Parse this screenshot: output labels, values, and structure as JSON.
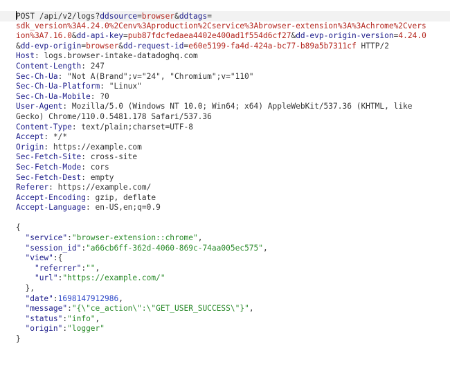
{
  "request_line": {
    "method": "POST",
    "path": "/api/v2/logs?",
    "params": [
      {
        "key": "ddsource",
        "value": "browser"
      },
      {
        "key": "ddtags",
        "value": "sdk_version%3A4.24.0%2Cenv%3Aproduction%2Cservice%3Abrowser-extension%3A%3Achrome%2Cversion%3A7.16.0"
      },
      {
        "key": "dd-api-key",
        "value": "pub87fdcfedaea4402e400ad1f554d6cf27"
      },
      {
        "key": "dd-evp-origin-version",
        "value": "4.24.0"
      },
      {
        "key": "dd-evp-origin",
        "value": "browser"
      },
      {
        "key": "dd-request-id",
        "value": "e60e5199-fa4d-424a-bc77-b89a5b7311cf"
      }
    ],
    "protocol": "HTTP/2",
    "wrapped_lines": {
      "l1_tail": "sdk_version%3A4.24.0%2Cenv%3Aproduction%2Cservice%3Abrowser-extension%3A%3Achrome%2Cvers",
      "l2_head": "ion%3A7.16.0",
      "l3_tail": "4.24.0"
    }
  },
  "headers": [
    {
      "name": "Host",
      "value": "logs.browser-intake-datadoghq.com"
    },
    {
      "name": "Content-Length",
      "value": "247"
    },
    {
      "name": "Sec-Ch-Ua",
      "value": "\"Not A(Brand\";v=\"24\", \"Chromium\";v=\"110\""
    },
    {
      "name": "Sec-Ch-Ua-Platform",
      "value": "\"Linux\""
    },
    {
      "name": "Sec-Ch-Ua-Mobile",
      "value": "?0"
    },
    {
      "name": "User-Agent",
      "value": "Mozilla/5.0 (Windows NT 10.0; Win64; x64) AppleWebKit/537.36 (KHTML, like",
      "continuation": "Gecko) Chrome/110.0.5481.178 Safari/537.36"
    },
    {
      "name": "Content-Type",
      "value": "text/plain;charset=UTF-8"
    },
    {
      "name": "Accept",
      "value": "*/*"
    },
    {
      "name": "Origin",
      "value": "https://example.com"
    },
    {
      "name": "Sec-Fetch-Site",
      "value": "cross-site"
    },
    {
      "name": "Sec-Fetch-Mode",
      "value": "cors"
    },
    {
      "name": "Sec-Fetch-Dest",
      "value": "empty"
    },
    {
      "name": "Referer",
      "value": "https://example.com/"
    },
    {
      "name": "Accept-Encoding",
      "value": "gzip, deflate"
    },
    {
      "name": "Accept-Language",
      "value": "en-US,en;q=0.9"
    }
  ],
  "body": {
    "service": "\"browser-extension::chrome\"",
    "session_id": "\"a66cb6ff-362d-4060-869c-74aa005ec575\"",
    "view_referrer": "\"\"",
    "view_url": "\"https://example.com/\"",
    "date": "1698147912986",
    "message": "\"{\\\"ce_action\\\":\\\"GET_USER_SUCCESS\\\"}\"",
    "status": "\"info\"",
    "origin": "\"logger\""
  },
  "keys": {
    "service": "\"service\"",
    "session_id": "\"session_id\"",
    "view": "\"view\"",
    "referrer": "\"referrer\"",
    "url": "\"url\"",
    "date": "\"date\"",
    "message": "\"message\"",
    "status": "\"status\"",
    "origin": "\"origin\""
  },
  "punct": {
    "q": "?",
    "eq": "=",
    "amp": "&",
    "colon": ": ",
    "jcolon": ":",
    "comma": ",",
    "open": "{",
    "close": "}",
    "close_comma": "},",
    "open_obj": ":{",
    "space": " "
  }
}
